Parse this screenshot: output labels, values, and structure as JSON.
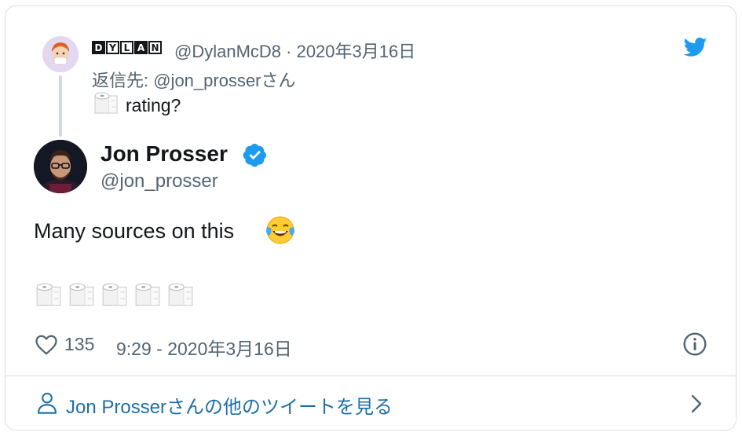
{
  "parent": {
    "display_name_letters": [
      "D",
      "Y",
      "L",
      "A",
      "N"
    ],
    "display_name_filled": [
      true,
      false,
      false,
      true,
      false
    ],
    "meta": "@DylanMcD8 · 2020年3月16日",
    "reply_to": "返信先: @jon_prosserさん",
    "text": "rating?",
    "emoji_icon": "toilet-paper-icon"
  },
  "tweet": {
    "author_name": "Jon Prosser",
    "author_handle": "@jon_prosser",
    "verified": true,
    "text": "Many sources on this",
    "text_emoji": "face-with-tears-of-joy-icon",
    "toilet_paper_count": 5,
    "like_count": "135",
    "timestamp": "9:29 - 2020年3月16日"
  },
  "footer": {
    "more_link": "Jon Prosserさんの他のツイートを見る"
  },
  "colors": {
    "twitter_blue": "#1d9bf0",
    "muted": "#536471",
    "link": "#1d6fa8",
    "border": "#d8dee3"
  }
}
